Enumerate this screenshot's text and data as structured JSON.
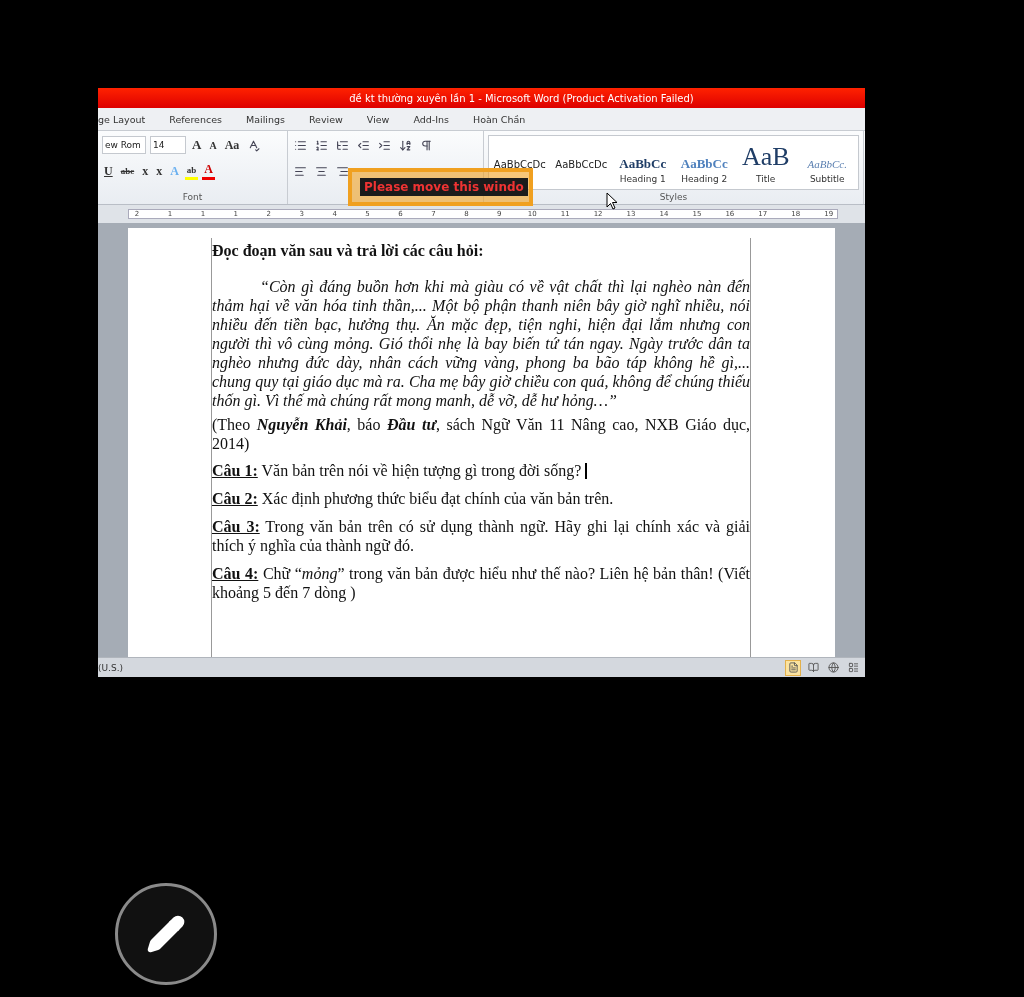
{
  "window": {
    "title": "đề kt thường xuyên lần 1  -  Microsoft Word (Product Activation Failed)"
  },
  "tabs": [
    {
      "label": "ge Layout",
      "selected": false
    },
    {
      "label": "References",
      "selected": false
    },
    {
      "label": "Mailings",
      "selected": false
    },
    {
      "label": "Review",
      "selected": false
    },
    {
      "label": "View",
      "selected": false
    },
    {
      "label": "Add-Ins",
      "selected": false
    },
    {
      "label": "Hoàn Chần",
      "selected": false
    }
  ],
  "font_group": {
    "label": "Font",
    "font_name": "ew Rom",
    "font_size": "14",
    "row1": [
      {
        "kind": "grow",
        "label": "A"
      },
      {
        "kind": "shrink",
        "label": "A"
      },
      {
        "kind": "case",
        "label": "Aa"
      }
    ],
    "row2": [
      {
        "kind": "underline",
        "label": "U"
      },
      {
        "kind": "strike",
        "label": "abc"
      },
      {
        "kind": "sub",
        "label": "x"
      },
      {
        "kind": "sup",
        "label": "x"
      },
      {
        "kind": "effects",
        "label": "A"
      },
      {
        "kind": "highlight",
        "label": "ab"
      },
      {
        "kind": "color",
        "label": "A"
      }
    ]
  },
  "styles_group": {
    "label": "Styles",
    "styles": [
      {
        "kind": "normal",
        "preview": "AaBbCcDc"
      },
      {
        "kind": "normal",
        "preview": "AaBbCcDc"
      },
      {
        "kind": "heading",
        "preview": "AaBbCc",
        "name": "Heading 1"
      },
      {
        "kind": "heading2",
        "preview": "AaBbCc",
        "name": "Heading 2"
      },
      {
        "kind": "title",
        "preview": "AaB",
        "name": "Title"
      },
      {
        "kind": "subtitle",
        "preview": "AaBbCc.",
        "name": "Subtitle"
      }
    ]
  },
  "overlay": {
    "message": "Please move this windo"
  },
  "ruler": {
    "labels": [
      "2",
      "1",
      "1",
      "1",
      "2",
      "3",
      "4",
      "5",
      "6",
      "7",
      "8",
      "9",
      "10",
      "11",
      "12",
      "13",
      "14",
      "15",
      "16",
      "17",
      "18",
      "19"
    ]
  },
  "document": {
    "heading": "Đọc đoạn văn sau và trả lời các câu hỏi:",
    "quote": "“Còn gì đáng buồn hơn khi mà giàu có về vật chất thì lại nghèo nàn đến thảm hại về văn hóa tinh thần,... Một bộ phận thanh niên bây giờ nghĩ nhiều, nói nhiều đến tiền bạc, hưởng thụ. Ăn mặc đẹp, tiện nghi, hiện đại lắm nhưng con người thì vô cùng mỏng. Gió thổi nhẹ là bay biến tứ tán ngay. Ngày trước dân ta nghèo nhưng đức dày, nhân cách vững vàng, phong ba bão táp không hề gì,... chung quy tại giáo dục mà ra. Cha mẹ bây giờ chiều con quá, không để chúng thiếu thốn gì. Vì thế mà chúng rất mong manh, dễ vỡ, dễ hư hỏng…”",
    "citation": "(Theo **Nguyễn Khải**, báo **Đầu tư**, sách Ngữ Văn 11 Nâng cao, NXB Giáo dục, 2014)",
    "questions": [
      {
        "label": "Câu 1:",
        "text": "Văn bản trên nói về hiện tượng gì trong đời sống?",
        "cursor": true
      },
      {
        "label": "Câu 2:",
        "text": "Xác định phương thức biểu đạt chính của văn bản trên.",
        "cursor": false
      },
      {
        "label": "Câu 3:",
        "text": "Trong văn bản trên có sử dụng thành ngữ. Hãy ghi lại chính xác và giải thích ý nghĩa của thành ngữ đó.",
        "cursor": false
      },
      {
        "label": "Câu 4:",
        "text": "Chữ “*mỏng*” trong văn bản được hiểu như thế nào? Liên hệ bản thân! (Viết khoảng 5 đến 7 dòng )",
        "cursor": false
      }
    ]
  },
  "status_bar": {
    "language": "(U.S.)",
    "views": [
      {
        "kind": "print",
        "selected": true
      },
      {
        "kind": "reading",
        "selected": false
      },
      {
        "kind": "web",
        "selected": false
      },
      {
        "kind": "outline",
        "selected": false
      }
    ]
  }
}
